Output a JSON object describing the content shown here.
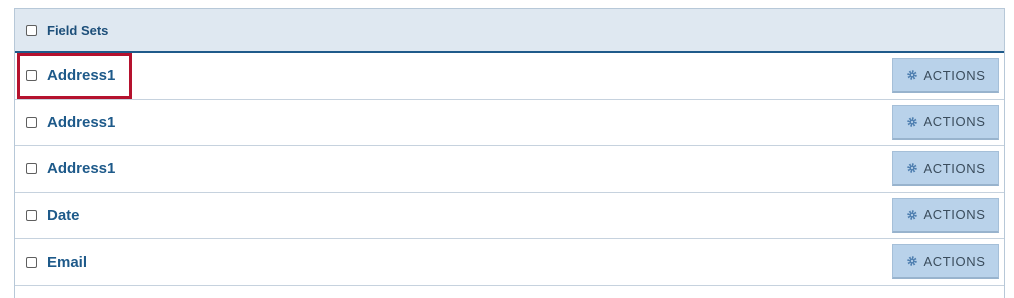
{
  "header": {
    "label": "Field Sets"
  },
  "rows": [
    {
      "label": "Address1",
      "action_label": "ACTIONS"
    },
    {
      "label": "Address1",
      "action_label": "ACTIONS"
    },
    {
      "label": "Address1",
      "action_label": "ACTIONS"
    },
    {
      "label": "Date",
      "action_label": "ACTIONS"
    },
    {
      "label": "Email",
      "action_label": "ACTIONS"
    }
  ],
  "icons": {
    "action_icon": "gear-icon"
  },
  "colors": {
    "header_bg": "#dfe8f1",
    "header_border": "#1f5a8a",
    "link_text": "#1e5a8a",
    "button_bg": "#b9d2ea",
    "highlight": "#b5122e"
  }
}
